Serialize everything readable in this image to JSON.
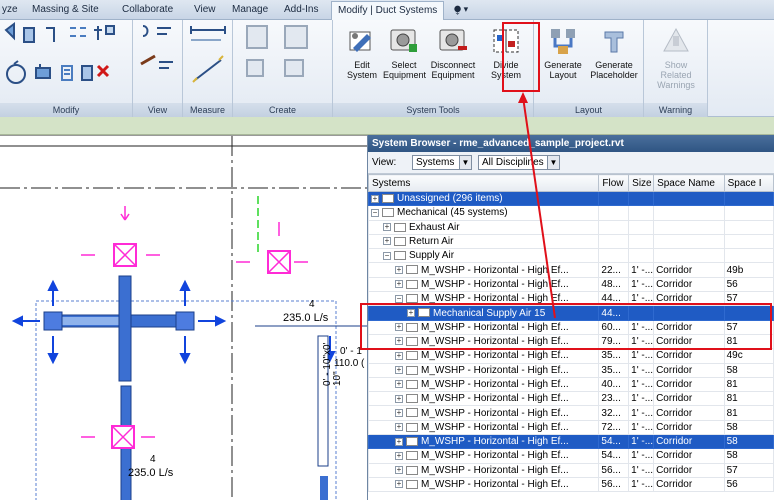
{
  "tabs": [
    "yze",
    "Massing & Site",
    "Collaborate",
    "View",
    "Manage",
    "Add-Ins",
    "Modify | Duct Systems"
  ],
  "tab_extra": "⧭ ▾",
  "panels": {
    "modify": "Modify",
    "view": "View",
    "measure": "Measure",
    "create": "Create",
    "system_tools": "System Tools",
    "layout": "Layout",
    "warning": "Warning"
  },
  "buttons": {
    "edit_system": "Edit System",
    "select_equipment": "Select Equipment",
    "disconnect_equipment": "Disconnect Equipment",
    "divide_system": "Divide System",
    "generate_layout": "Generate Layout",
    "generate_placeholder": "Generate Placeholder",
    "show_related_warnings": "Show Related Warnings"
  },
  "browser": {
    "title": "System Browser - rme_advanced_sample_project.rvt",
    "view_label": "View:",
    "view_select": "Systems",
    "discipline_select": "All Disciplines",
    "columns": [
      "Systems",
      "Flow",
      "Size",
      "Space Name",
      "Space I"
    ],
    "rows": [
      {
        "indent": 0,
        "tree": "+",
        "icon": "folder",
        "label": "Unassigned (296 items)",
        "flow": "",
        "size": "",
        "space": "",
        "num": "",
        "hl": true
      },
      {
        "indent": 0,
        "tree": "−",
        "icon": "folder",
        "label": "Mechanical (45 systems)",
        "flow": "",
        "size": "",
        "space": "",
        "num": "",
        "hl": false
      },
      {
        "indent": 1,
        "tree": "+",
        "icon": "exhaust",
        "label": "Exhaust Air",
        "flow": "",
        "size": "",
        "space": "",
        "num": "",
        "hl": false
      },
      {
        "indent": 1,
        "tree": "+",
        "icon": "return",
        "label": "Return Air",
        "flow": "",
        "size": "",
        "space": "",
        "num": "",
        "hl": false
      },
      {
        "indent": 1,
        "tree": "−",
        "icon": "supply",
        "label": "Supply Air",
        "flow": "",
        "size": "",
        "space": "",
        "num": "",
        "hl": false
      },
      {
        "indent": 2,
        "tree": "+",
        "icon": "unit",
        "label": "M_WSHP - Horizontal - High Ef...",
        "flow": "22...",
        "size": "1' -...",
        "space": "Corridor",
        "num": "49b",
        "hl": false
      },
      {
        "indent": 2,
        "tree": "+",
        "icon": "unit",
        "label": "M_WSHP - Horizontal - High Ef...",
        "flow": "48...",
        "size": "1' -...",
        "space": "Corridor",
        "num": "56",
        "hl": false
      },
      {
        "indent": 2,
        "tree": "−",
        "icon": "unit",
        "label": "M_WSHP - Horizontal - High Ef...",
        "flow": "44...",
        "size": "1' -...",
        "space": "Corridor",
        "num": "57",
        "hl": false
      },
      {
        "indent": 3,
        "tree": "+",
        "icon": "system",
        "label": "Mechanical Supply Air 15",
        "flow": "44...",
        "size": "",
        "space": "",
        "num": "",
        "hl": true
      },
      {
        "indent": 2,
        "tree": "+",
        "icon": "unit",
        "label": "M_WSHP - Horizontal - High Ef...",
        "flow": "60...",
        "size": "1' -...",
        "space": "Corridor",
        "num": "57",
        "hl": false
      },
      {
        "indent": 2,
        "tree": "+",
        "icon": "unit",
        "label": "M_WSHP - Horizontal - High Ef...",
        "flow": "79...",
        "size": "1' -...",
        "space": "Corridor",
        "num": "81",
        "hl": false
      },
      {
        "indent": 2,
        "tree": "+",
        "icon": "unit",
        "label": "M_WSHP - Horizontal - High Ef...",
        "flow": "35...",
        "size": "1' -...",
        "space": "Corridor",
        "num": "49c",
        "hl": false
      },
      {
        "indent": 2,
        "tree": "+",
        "icon": "unit",
        "label": "M_WSHP - Horizontal - High Ef...",
        "flow": "35...",
        "size": "1' -...",
        "space": "Corridor",
        "num": "58",
        "hl": false
      },
      {
        "indent": 2,
        "tree": "+",
        "icon": "unit",
        "label": "M_WSHP - Horizontal - High Ef...",
        "flow": "40...",
        "size": "1' -...",
        "space": "Corridor",
        "num": "81",
        "hl": false
      },
      {
        "indent": 2,
        "tree": "+",
        "icon": "unit",
        "label": "M_WSHP - Horizontal - High Ef...",
        "flow": "23...",
        "size": "1' -...",
        "space": "Corridor",
        "num": "81",
        "hl": false
      },
      {
        "indent": 2,
        "tree": "+",
        "icon": "unit",
        "label": "M_WSHP - Horizontal - High Ef...",
        "flow": "32...",
        "size": "1' -...",
        "space": "Corridor",
        "num": "81",
        "hl": false
      },
      {
        "indent": 2,
        "tree": "+",
        "icon": "unit",
        "label": "M_WSHP - Horizontal - High Ef...",
        "flow": "72...",
        "size": "1' -...",
        "space": "Corridor",
        "num": "58",
        "hl": false
      },
      {
        "indent": 2,
        "tree": "+",
        "icon": "unit",
        "label": "M_WSHP - Horizontal - High Ef...",
        "flow": "54...",
        "size": "1' -...",
        "space": "Corridor",
        "num": "58",
        "hl": true
      },
      {
        "indent": 2,
        "tree": "+",
        "icon": "unit",
        "label": "M_WSHP - Horizontal - High Ef...",
        "flow": "54...",
        "size": "1' -...",
        "space": "Corridor",
        "num": "58",
        "hl": false
      },
      {
        "indent": 2,
        "tree": "+",
        "icon": "unit",
        "label": "M_WSHP - Horizontal - High Ef...",
        "flow": "56...",
        "size": "1' -...",
        "space": "Corridor",
        "num": "57",
        "hl": false
      },
      {
        "indent": 2,
        "tree": "+",
        "icon": "unit",
        "label": "M_WSHP - Horizontal - High Ef...",
        "flow": "56...",
        "size": "1' -...",
        "space": "Corridor",
        "num": "56",
        "hl": false
      }
    ]
  },
  "canvas": {
    "flow_1": "235.0 L/s",
    "tag_1": "4",
    "flow_2": "235.0 L/s",
    "tag_2": "4",
    "duct_a": "0' - 1",
    "duct_b": "110.0 (",
    "duct_c": "0' - 10\"x0'",
    "duct_d": "10\""
  },
  "colors": {
    "highlight": "#1f5bc4",
    "annotation": "#e0101a",
    "duct": "#3b6fd1",
    "terminal": "#ff2bd6"
  }
}
